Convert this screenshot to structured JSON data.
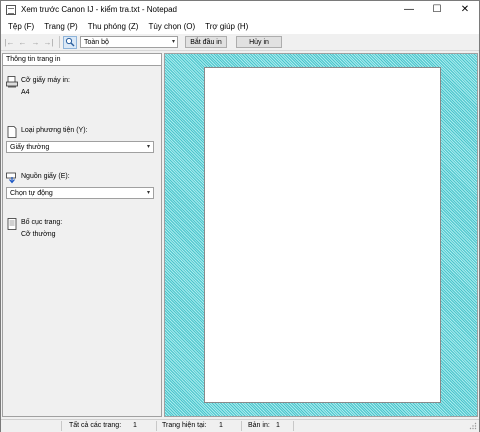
{
  "window": {
    "title": "Xem trước Canon IJ - kiểm tra.txt - Notepad",
    "controls": {
      "minimize": "—",
      "maximize": "☐",
      "close": "✕"
    }
  },
  "menu": {
    "items": [
      "Tệp (F)",
      "Trang (P)",
      "Thu phóng (Z)",
      "Tùy chọn (O)",
      "Trợ giúp (H)"
    ]
  },
  "toolbar": {
    "nav": [
      "|←",
      "←",
      "→",
      "→|"
    ],
    "zoom_value": "Toàn bộ",
    "start_print": "Bắt đầu in",
    "cancel_print": "Hủy in"
  },
  "panel": {
    "header": "Thông tin trang in",
    "paper_size_label": "Cỡ giấy máy in:",
    "paper_size_value": "A4",
    "media_type_label": "Loại phương tiện (Y):",
    "media_type_value": "Giấy thường",
    "paper_source_label": "Nguồn giấy (E):",
    "paper_source_value": "Chọn tự động",
    "layout_label": "Bố cục trang:",
    "layout_value": "Cỡ thường"
  },
  "status": {
    "total_pages_label": "Tất cả các trang:",
    "total_pages": "1",
    "current_page_label": "Trang hiện tại:",
    "current_page": "1",
    "copies_label": "Bản in:",
    "copies": "1"
  },
  "icons": {
    "dropdown": "▾"
  },
  "colors": {
    "preview_bg": "#5fd0d6",
    "accent": "#0078d7"
  }
}
